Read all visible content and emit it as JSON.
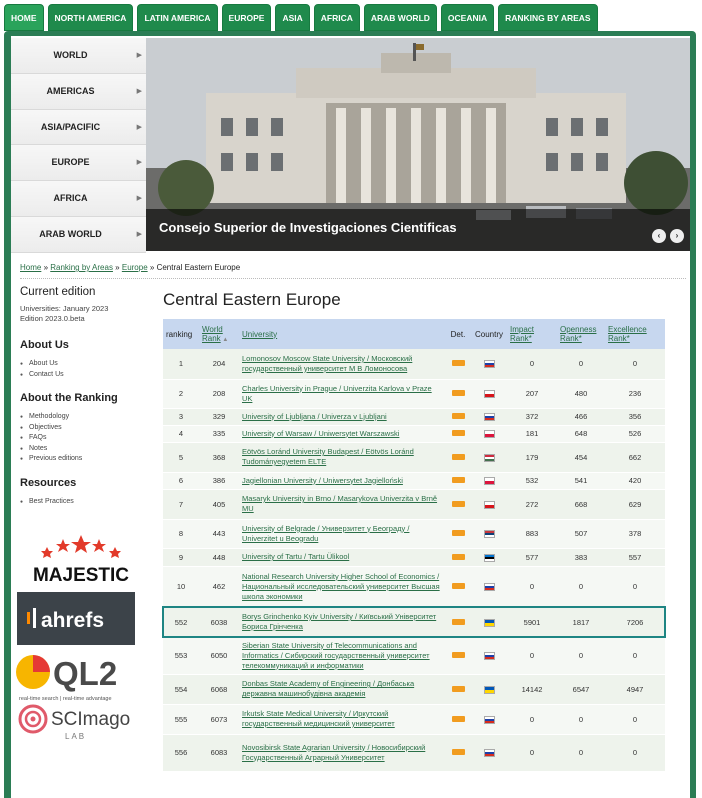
{
  "top_tabs": [
    "HOME",
    "NORTH AMERICA",
    "LATIN AMERICA",
    "EUROPE",
    "ASIA",
    "AFRICA",
    "ARAB WORLD",
    "OCEANIA",
    "RANKING BY AREAS"
  ],
  "region_menu": [
    "WORLD",
    "AMERICAS",
    "ASIA/PACIFIC",
    "EUROPE",
    "AFRICA",
    "ARAB WORLD"
  ],
  "banner": {
    "caption": "Consejo Superior de Investigaciones Cientificas",
    "prev": "‹",
    "next": "›"
  },
  "breadcrumb": {
    "home": "Home",
    "sep1": " » ",
    "ranking": "Ranking by Areas",
    "sep2": " » ",
    "europe": "Europe",
    "sep3": " » ",
    "current": "Central Eastern Europe"
  },
  "left": {
    "current_edition_title": "Current edition",
    "edition_line1": "Universities: January 2023",
    "edition_line2": "Edition 2023.0.beta",
    "about_us_title": "About Us",
    "about_us_items": [
      "About Us",
      "Contact Us"
    ],
    "about_ranking_title": "About the Ranking",
    "about_ranking_items": [
      "Methodology",
      "Objectives",
      "FAQs",
      "Notes",
      "Previous editions"
    ],
    "resources_title": "Resources",
    "resources_items": [
      "Best Practices"
    ]
  },
  "logos": {
    "majestic": "MAJESTIC",
    "ahrefs": "ahrefs",
    "ql2": "QL2",
    "ql2_tagline": "real-time search | real-time advantage",
    "scimago": "SCImago",
    "scimago_sub": "LAB"
  },
  "main": {
    "title": "Central Eastern Europe",
    "headers": {
      "ranking": "ranking",
      "world_rank_1": "World",
      "world_rank_2": "Rank",
      "university": "University",
      "det": "Det.",
      "country": "Country",
      "impact_1": "Impact",
      "impact_2": "Rank*",
      "openness_1": "Openness",
      "openness_2": "Rank*",
      "excellence_1": "Excellence",
      "excellence_2": "Rank*"
    }
  },
  "rows": [
    {
      "rank": "1",
      "world": "204",
      "university": "Lomonosov Moscow State University / Московский государственный университет М В Ломоносова",
      "country": "Russia",
      "impact": "0",
      "openness": "0",
      "excellence": "0"
    },
    {
      "rank": "2",
      "world": "208",
      "university": "Charles University in Prague / Univerzita Karlova v Praze UK",
      "country": "Czechia",
      "impact": "207",
      "openness": "480",
      "excellence": "236"
    },
    {
      "rank": "3",
      "world": "329",
      "university": "University of Ljubljana / Univerza v Ljubljani",
      "country": "Slovenia",
      "impact": "372",
      "openness": "466",
      "excellence": "356"
    },
    {
      "rank": "4",
      "world": "335",
      "university": "University of Warsaw / Uniwersytet Warszawski",
      "country": "Poland",
      "impact": "181",
      "openness": "648",
      "excellence": "526"
    },
    {
      "rank": "5",
      "world": "368",
      "university": "Eötvös Loránd University Budapest / Eötvös Loránd Tudományegyetem ELTE",
      "country": "Hungary",
      "impact": "179",
      "openness": "454",
      "excellence": "662"
    },
    {
      "rank": "6",
      "world": "386",
      "university": "Jagiellonian University / Uniwersytet Jagielloński",
      "country": "Poland",
      "impact": "532",
      "openness": "541",
      "excellence": "420"
    },
    {
      "rank": "7",
      "world": "405",
      "university": "Masaryk University in Brno / Masarykova Univerzita v Brně MU",
      "country": "Czechia",
      "impact": "272",
      "openness": "668",
      "excellence": "629"
    },
    {
      "rank": "8",
      "world": "443",
      "university": "University of Belgrade / Универзитет у Београду / Univerzitet u Beogradu",
      "country": "Serbia",
      "impact": "883",
      "openness": "507",
      "excellence": "378"
    },
    {
      "rank": "9",
      "world": "448",
      "university": "University of Tartu / Tartu Ülikool",
      "country": "Estonia",
      "impact": "577",
      "openness": "383",
      "excellence": "557"
    },
    {
      "rank": "10",
      "world": "462",
      "university": "National Research University Higher School of Economics / Национальный исследовательский университет Высшая школа экономики",
      "country": "Russia",
      "impact": "0",
      "openness": "0",
      "excellence": "0"
    },
    {
      "rank": "552",
      "world": "6038",
      "university": "Borys Grinchenko Kyiv University / Київський Університет Бориса Грінченка",
      "country": "Ukraine",
      "impact": "5901",
      "openness": "1817",
      "excellence": "7206",
      "highlight": true
    },
    {
      "rank": "553",
      "world": "6050",
      "university": "Siberian State University of Telecommunications and Informatics / Сибирский государственный университет телекоммуникаций и информатики",
      "country": "Russia",
      "impact": "0",
      "openness": "0",
      "excellence": "0"
    },
    {
      "rank": "554",
      "world": "6068",
      "university": "Donbas State Academy of Engineering / Донбаська державна машинобудівна академія",
      "country": "Ukraine",
      "impact": "14142",
      "openness": "6547",
      "excellence": "4947"
    },
    {
      "rank": "555",
      "world": "6073",
      "university": "Irkutsk State Medical University / Иркутский государственный медицинский университет",
      "country": "Russia",
      "impact": "0",
      "openness": "0",
      "excellence": "0"
    },
    {
      "rank": "556",
      "world": "6083",
      "university": "Novosibirsk State Agrarian University / Новосибирский Государственный Аграрный Университет",
      "country": "Russia",
      "impact": "0",
      "openness": "0",
      "excellence": "0"
    }
  ],
  "colors": {
    "tab_green": "#1f8a4c",
    "frame_green": "#2b7d55",
    "header_blue": "#c7d7ef",
    "highlight": "#1e8583",
    "det_orange": "#f19c1f"
  }
}
